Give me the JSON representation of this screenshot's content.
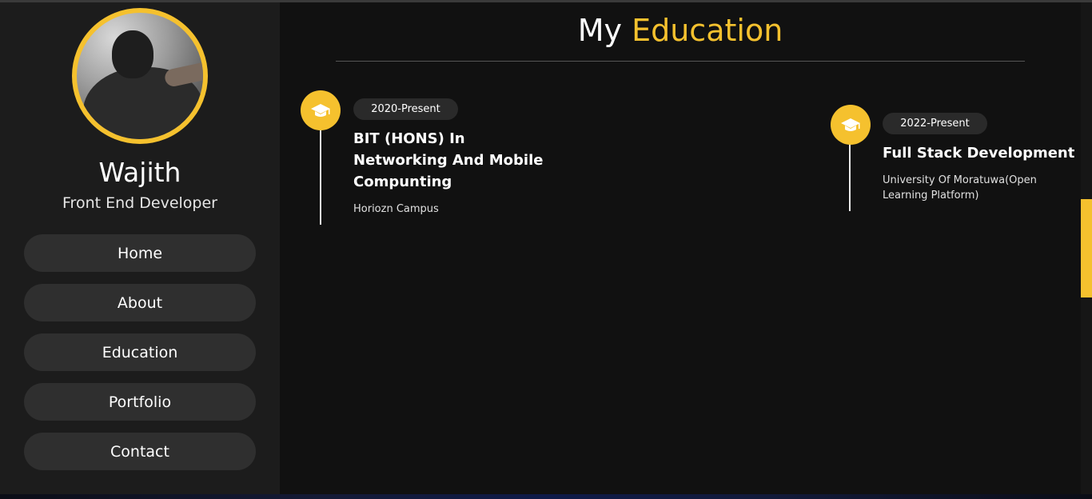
{
  "profile": {
    "name": "Wajith",
    "role": "Front End Developer"
  },
  "nav": {
    "items": [
      {
        "label": "Home"
      },
      {
        "label": "About"
      },
      {
        "label": "Education"
      },
      {
        "label": "Portfolio"
      },
      {
        "label": "Contact"
      }
    ]
  },
  "page": {
    "title_prefix": "My",
    "title_accent": "Education"
  },
  "education": [
    {
      "date": "2020-Present",
      "title": "BIT (HONS) In Networking And Mobile Compunting",
      "school": "Horiozn Campus",
      "icon": "graduation-cap-icon"
    },
    {
      "date": "2022-Present",
      "title": "Full Stack Development",
      "school": "University Of Moratuwa(Open Learning Platform)",
      "icon": "graduation-cap-icon"
    }
  ],
  "colors": {
    "accent": "#f5c12e",
    "sidebar_bg": "#1c1c1c",
    "main_bg": "#111111",
    "button_bg": "#2f2f2f"
  }
}
